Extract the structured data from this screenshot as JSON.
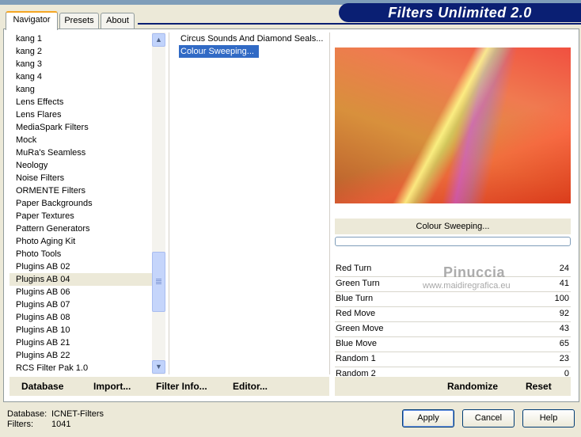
{
  "window": {
    "title": "Filters Unlimited 2.0"
  },
  "tabs": [
    {
      "label": "Navigator",
      "active": true
    },
    {
      "label": "Presets",
      "active": false
    },
    {
      "label": "About",
      "active": false
    }
  ],
  "categories": {
    "items": [
      "kang 1",
      "kang 2",
      "kang 3",
      "kang 4",
      "kang",
      "Lens Effects",
      "Lens Flares",
      "MediaSpark Filters",
      "Mock",
      "MuRa's Seamless",
      "Neology",
      "Noise Filters",
      "ORMENTE Filters",
      "Paper Backgrounds",
      "Paper Textures",
      "Pattern Generators",
      "Photo Aging Kit",
      "Photo Tools",
      "Plugins AB 02",
      "Plugins AB 04",
      "Plugins AB 06",
      "Plugins AB 07",
      "Plugins AB 08",
      "Plugins AB 10",
      "Plugins AB 21",
      "Plugins AB 22",
      "RCS Filter Pak 1.0"
    ],
    "selected": "Plugins AB 04"
  },
  "effects": {
    "items": [
      "Circus Sounds And Diamond Seals...",
      "Colour Sweeping..."
    ],
    "selected": "Colour Sweeping..."
  },
  "preview": {
    "label": "Colour Sweeping..."
  },
  "params": [
    {
      "label": "Red Turn",
      "value": "24"
    },
    {
      "label": "Green Turn",
      "value": "41"
    },
    {
      "label": "Blue Turn",
      "value": "100"
    },
    {
      "label": "Red Move",
      "value": "92"
    },
    {
      "label": "Green Move",
      "value": "43"
    },
    {
      "label": "Blue Move",
      "value": "65"
    },
    {
      "label": "Random 1",
      "value": "23"
    },
    {
      "label": "Random 2",
      "value": "0"
    }
  ],
  "watermark": {
    "name": "Pinuccia",
    "url": "www.maidiregrafica.eu"
  },
  "left_buttons": {
    "database": "Database",
    "import": "Import...",
    "filter_info": "Filter Info...",
    "editor": "Editor..."
  },
  "right_buttons": {
    "randomize": "Randomize",
    "reset": "Reset"
  },
  "status": {
    "database_label": "Database:",
    "database_value": "ICNET-Filters",
    "filters_label": "Filters:",
    "filters_value": "1041"
  },
  "dialog_buttons": {
    "apply": "Apply",
    "cancel": "Cancel",
    "help": "Help"
  }
}
